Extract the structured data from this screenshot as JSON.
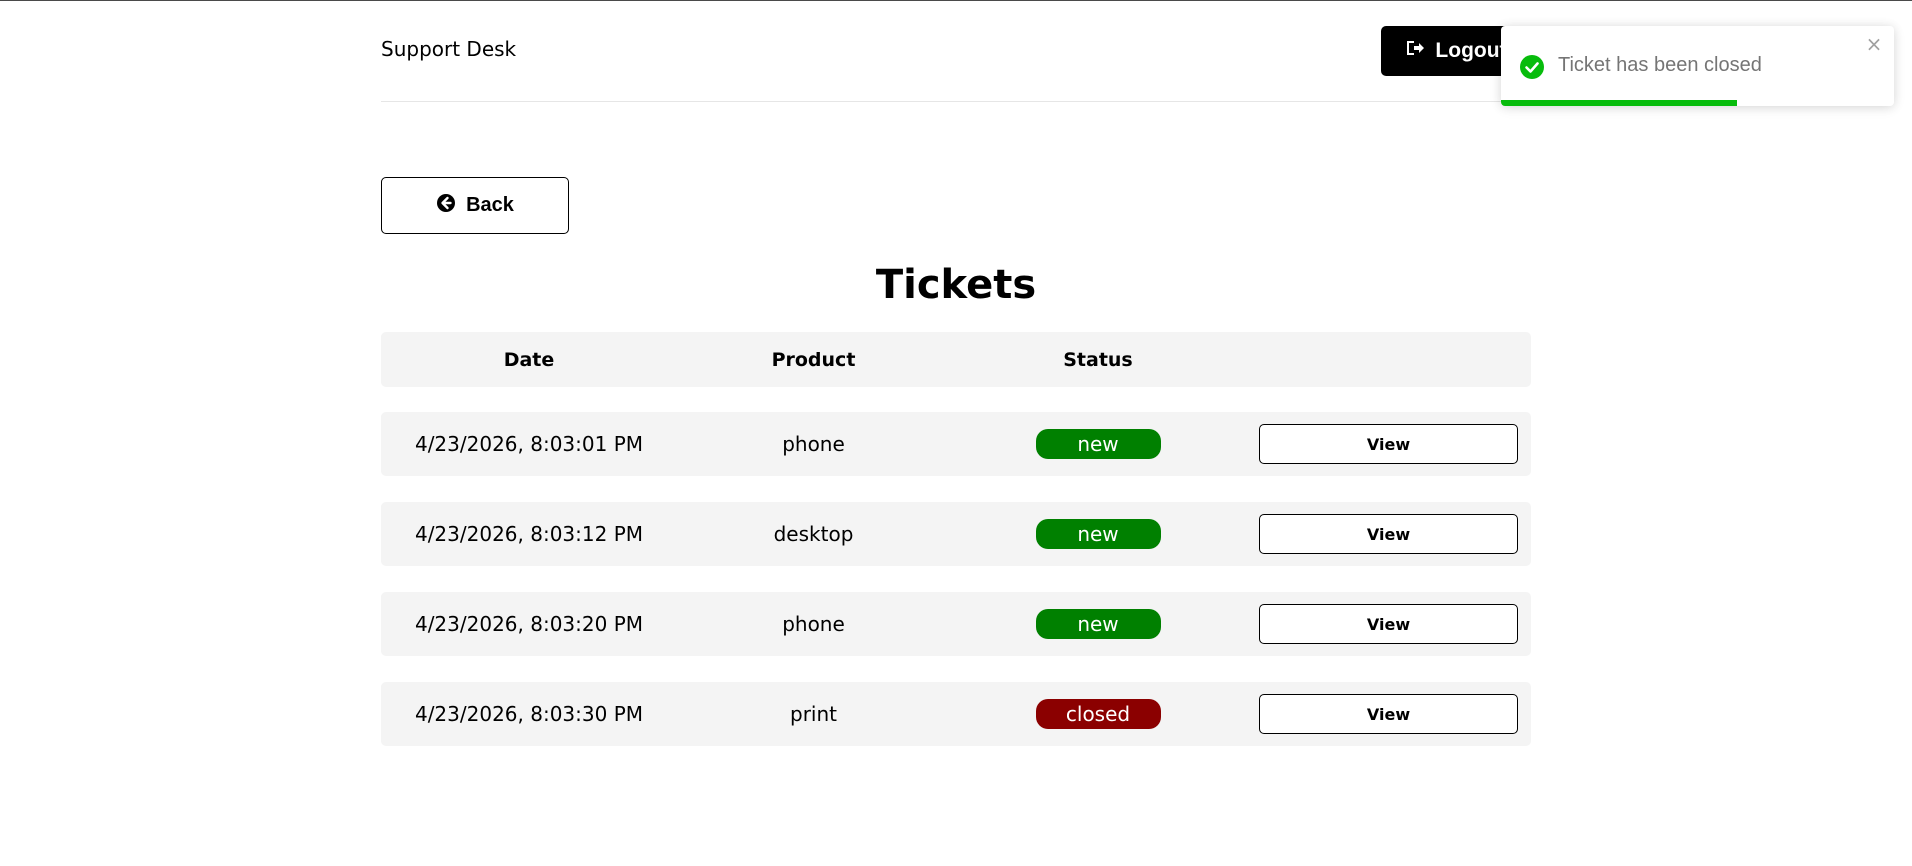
{
  "header": {
    "brand": "Support Desk",
    "logout_label": "Logout"
  },
  "back_label": "Back",
  "page_title": "Tickets",
  "table": {
    "columns": [
      "Date",
      "Product",
      "Status"
    ],
    "rows": [
      {
        "date": "4/23/2026, 8:03:01 PM",
        "product": "phone",
        "status": "new",
        "action": "View"
      },
      {
        "date": "4/23/2026, 8:03:12 PM",
        "product": "desktop",
        "status": "new",
        "action": "View"
      },
      {
        "date": "4/23/2026, 8:03:20 PM",
        "product": "phone",
        "status": "new",
        "action": "View"
      },
      {
        "date": "4/23/2026, 8:03:30 PM",
        "product": "print",
        "status": "closed",
        "action": "View"
      }
    ]
  },
  "status_colors": {
    "new": "#008000",
    "closed": "#8b0000"
  },
  "toast": {
    "message": "Ticket has been closed",
    "close_glyph": "×",
    "icon": "check-circle-icon",
    "progress_fraction": 0.6,
    "color": "#07bc0c"
  }
}
